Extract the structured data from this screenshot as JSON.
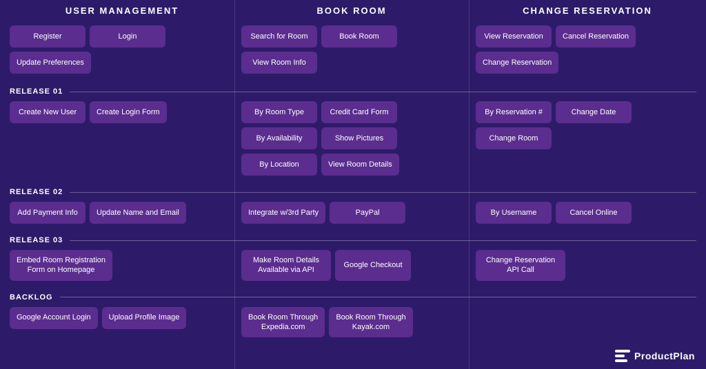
{
  "columns": {
    "col1": {
      "header": "USER MANAGEMENT"
    },
    "col2": {
      "header": "BOOK ROOM"
    },
    "col3": {
      "header": "CHANGE RESERVATION"
    }
  },
  "sections": {
    "top": {
      "col1": [
        [
          "Register",
          "Login"
        ],
        [
          "Update Preferences"
        ]
      ],
      "col2": [
        [
          "Search for Room",
          "Book Room"
        ],
        [
          "View Room Info"
        ]
      ],
      "col3": [
        [
          "View Reservation",
          "Cancel Reservation"
        ],
        [
          "Change Reservation"
        ]
      ]
    },
    "release01": {
      "label": "RELEASE 01",
      "col1": [
        [
          "Create New User",
          "Create Login Form"
        ]
      ],
      "col2": [
        [
          "By Room Type",
          "Credit Card Form"
        ],
        [
          "By Availability",
          "Show Pictures"
        ],
        [
          "By Location",
          "View Room Details"
        ]
      ],
      "col3": [
        [
          "By Reservation #",
          "Change Date"
        ],
        [
          "Change Room"
        ]
      ]
    },
    "release02": {
      "label": "RELEASE 02",
      "col1": [
        [
          "Add Payment Info",
          "Update Name and Email"
        ]
      ],
      "col2": [
        [
          "Integrate w/3rd Party",
          "PayPal"
        ]
      ],
      "col3": [
        [
          "By Username",
          "Cancel Online"
        ]
      ]
    },
    "release03": {
      "label": "RELEASE 03",
      "col1": [
        [
          "Embed Room Registration\nForm on Homepage"
        ]
      ],
      "col2": [
        [
          "Make Room Details\nAvailable via API",
          "Google Checkout"
        ]
      ],
      "col3": [
        [
          "Change Reservation\nAPI Call"
        ]
      ]
    },
    "backlog": {
      "label": "BACKLOG",
      "col1": [
        [
          "Google Account Login",
          "Upload Profile Image"
        ]
      ],
      "col2": [
        [
          "Book Room Through\nExpedia.com",
          "Book Room Through\nKayak.com"
        ]
      ],
      "col3": []
    }
  },
  "logo": {
    "text": "ProductPlan"
  }
}
